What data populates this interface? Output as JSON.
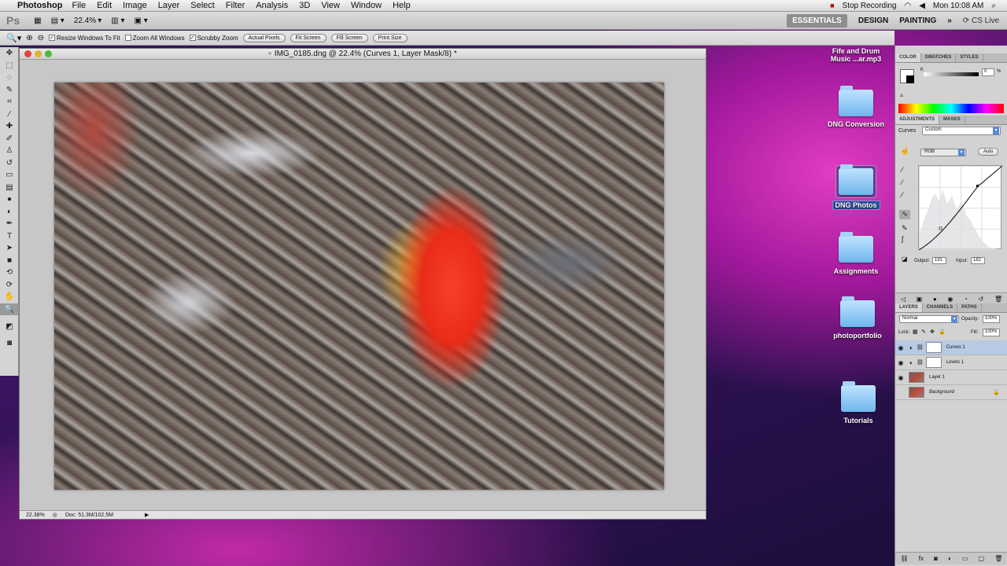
{
  "menubar": {
    "app_name": "Photoshop",
    "items": [
      "File",
      "Edit",
      "Image",
      "Layer",
      "Select",
      "Filter",
      "Analysis",
      "3D",
      "View",
      "Window",
      "Help"
    ],
    "recording": "Stop Recording",
    "clock": "Mon 10:08 AM"
  },
  "appbar": {
    "logo": "Ps",
    "zoom": "22.4%",
    "workspaces": [
      "ESSENTIALS",
      "DESIGN",
      "PAINTING"
    ],
    "more": "»",
    "cs_live": "CS Live"
  },
  "options": {
    "resize_windows": "Resize Windows To Fit",
    "zoom_all": "Zoom All Windows",
    "scrubby": "Scrubby Zoom",
    "actual_pixels": "Actual Pixels",
    "fit_screen": "Fit Screen",
    "fill_screen": "Fill Screen",
    "print_size": "Print Size"
  },
  "document": {
    "title": "IMG_0185.dng @ 22.4% (Curves 1, Layer Mask/8) *",
    "zoom": "22.38%",
    "doc_size": "Doc: 51.3M/102.5M"
  },
  "color_panel": {
    "tabs": [
      "COLOR",
      "SWATCHES",
      "STYLES"
    ],
    "channel": "K",
    "value": "0",
    "unit": "%"
  },
  "adjustments": {
    "tabs": [
      "ADJUSTMENTS",
      "MASKS"
    ],
    "type": "Curves",
    "preset": "Custom",
    "channel": "RGB",
    "auto": "Auto",
    "output_label": "Output:",
    "output_value": "191",
    "input_label": "Input:",
    "input_value": "182"
  },
  "layers_panel": {
    "tabs": [
      "LAYERS",
      "CHANNELS",
      "PATHS"
    ],
    "blend_mode": "Normal",
    "opacity_label": "Opacity:",
    "opacity": "100%",
    "lock_label": "Lock:",
    "fill_label": "Fill:",
    "fill": "100%",
    "layers": [
      {
        "name": "Curves 1"
      },
      {
        "name": "Levels 1"
      },
      {
        "name": "Layer 1"
      },
      {
        "name": "Background"
      }
    ]
  },
  "desktop": {
    "icons": [
      {
        "label": "Fife and Drum Music ...ar.mp3"
      },
      {
        "label": "DNG Conversion"
      },
      {
        "label": "DNG Photos"
      },
      {
        "label": "Assignments"
      },
      {
        "label": "photoportfolio"
      },
      {
        "label": "Tutorials"
      }
    ]
  }
}
